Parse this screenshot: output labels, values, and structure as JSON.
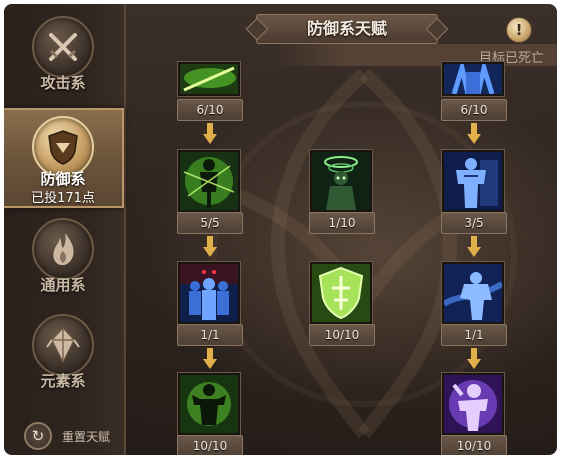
{
  "header": {
    "title": "防御系天赋",
    "description": "目标已死亡",
    "info_label": "!"
  },
  "sidebar": {
    "tabs": [
      {
        "label": "攻击系",
        "icon": "crossed-swords-icon",
        "selected": false
      },
      {
        "label": "防御系",
        "icon": "shield-icon",
        "selected": true,
        "sub_label": "已投171点"
      },
      {
        "label": "通用系",
        "icon": "flame-icon",
        "selected": false
      },
      {
        "label": "元素系",
        "icon": "crystal-icon",
        "selected": false
      }
    ],
    "reset_label": "重置天赋"
  },
  "talents": {
    "left": [
      {
        "level": "6/10",
        "icon": "green-slash-icon"
      },
      {
        "level": "5/5",
        "icon": "green-energy-man-icon"
      },
      {
        "level": "1/1",
        "icon": "blue-army-icon"
      },
      {
        "level": "10/10",
        "icon": "green-muscle-man-icon"
      }
    ],
    "middle": [
      {
        "level": "1/10",
        "icon": "halo-figure-icon"
      },
      {
        "level": "10/10",
        "icon": "green-shield-icon"
      }
    ],
    "right": [
      {
        "level": "6/10",
        "icon": "blue-figure-icon"
      },
      {
        "level": "3/5",
        "icon": "blue-muscle-man-icon"
      },
      {
        "level": "1/1",
        "icon": "blue-dash-figure-icon"
      },
      {
        "level": "10/10",
        "icon": "purple-figure-icon"
      }
    ]
  },
  "colors": {
    "accent_gold": "#e2b04a",
    "panel_dark": "#2c231e"
  }
}
